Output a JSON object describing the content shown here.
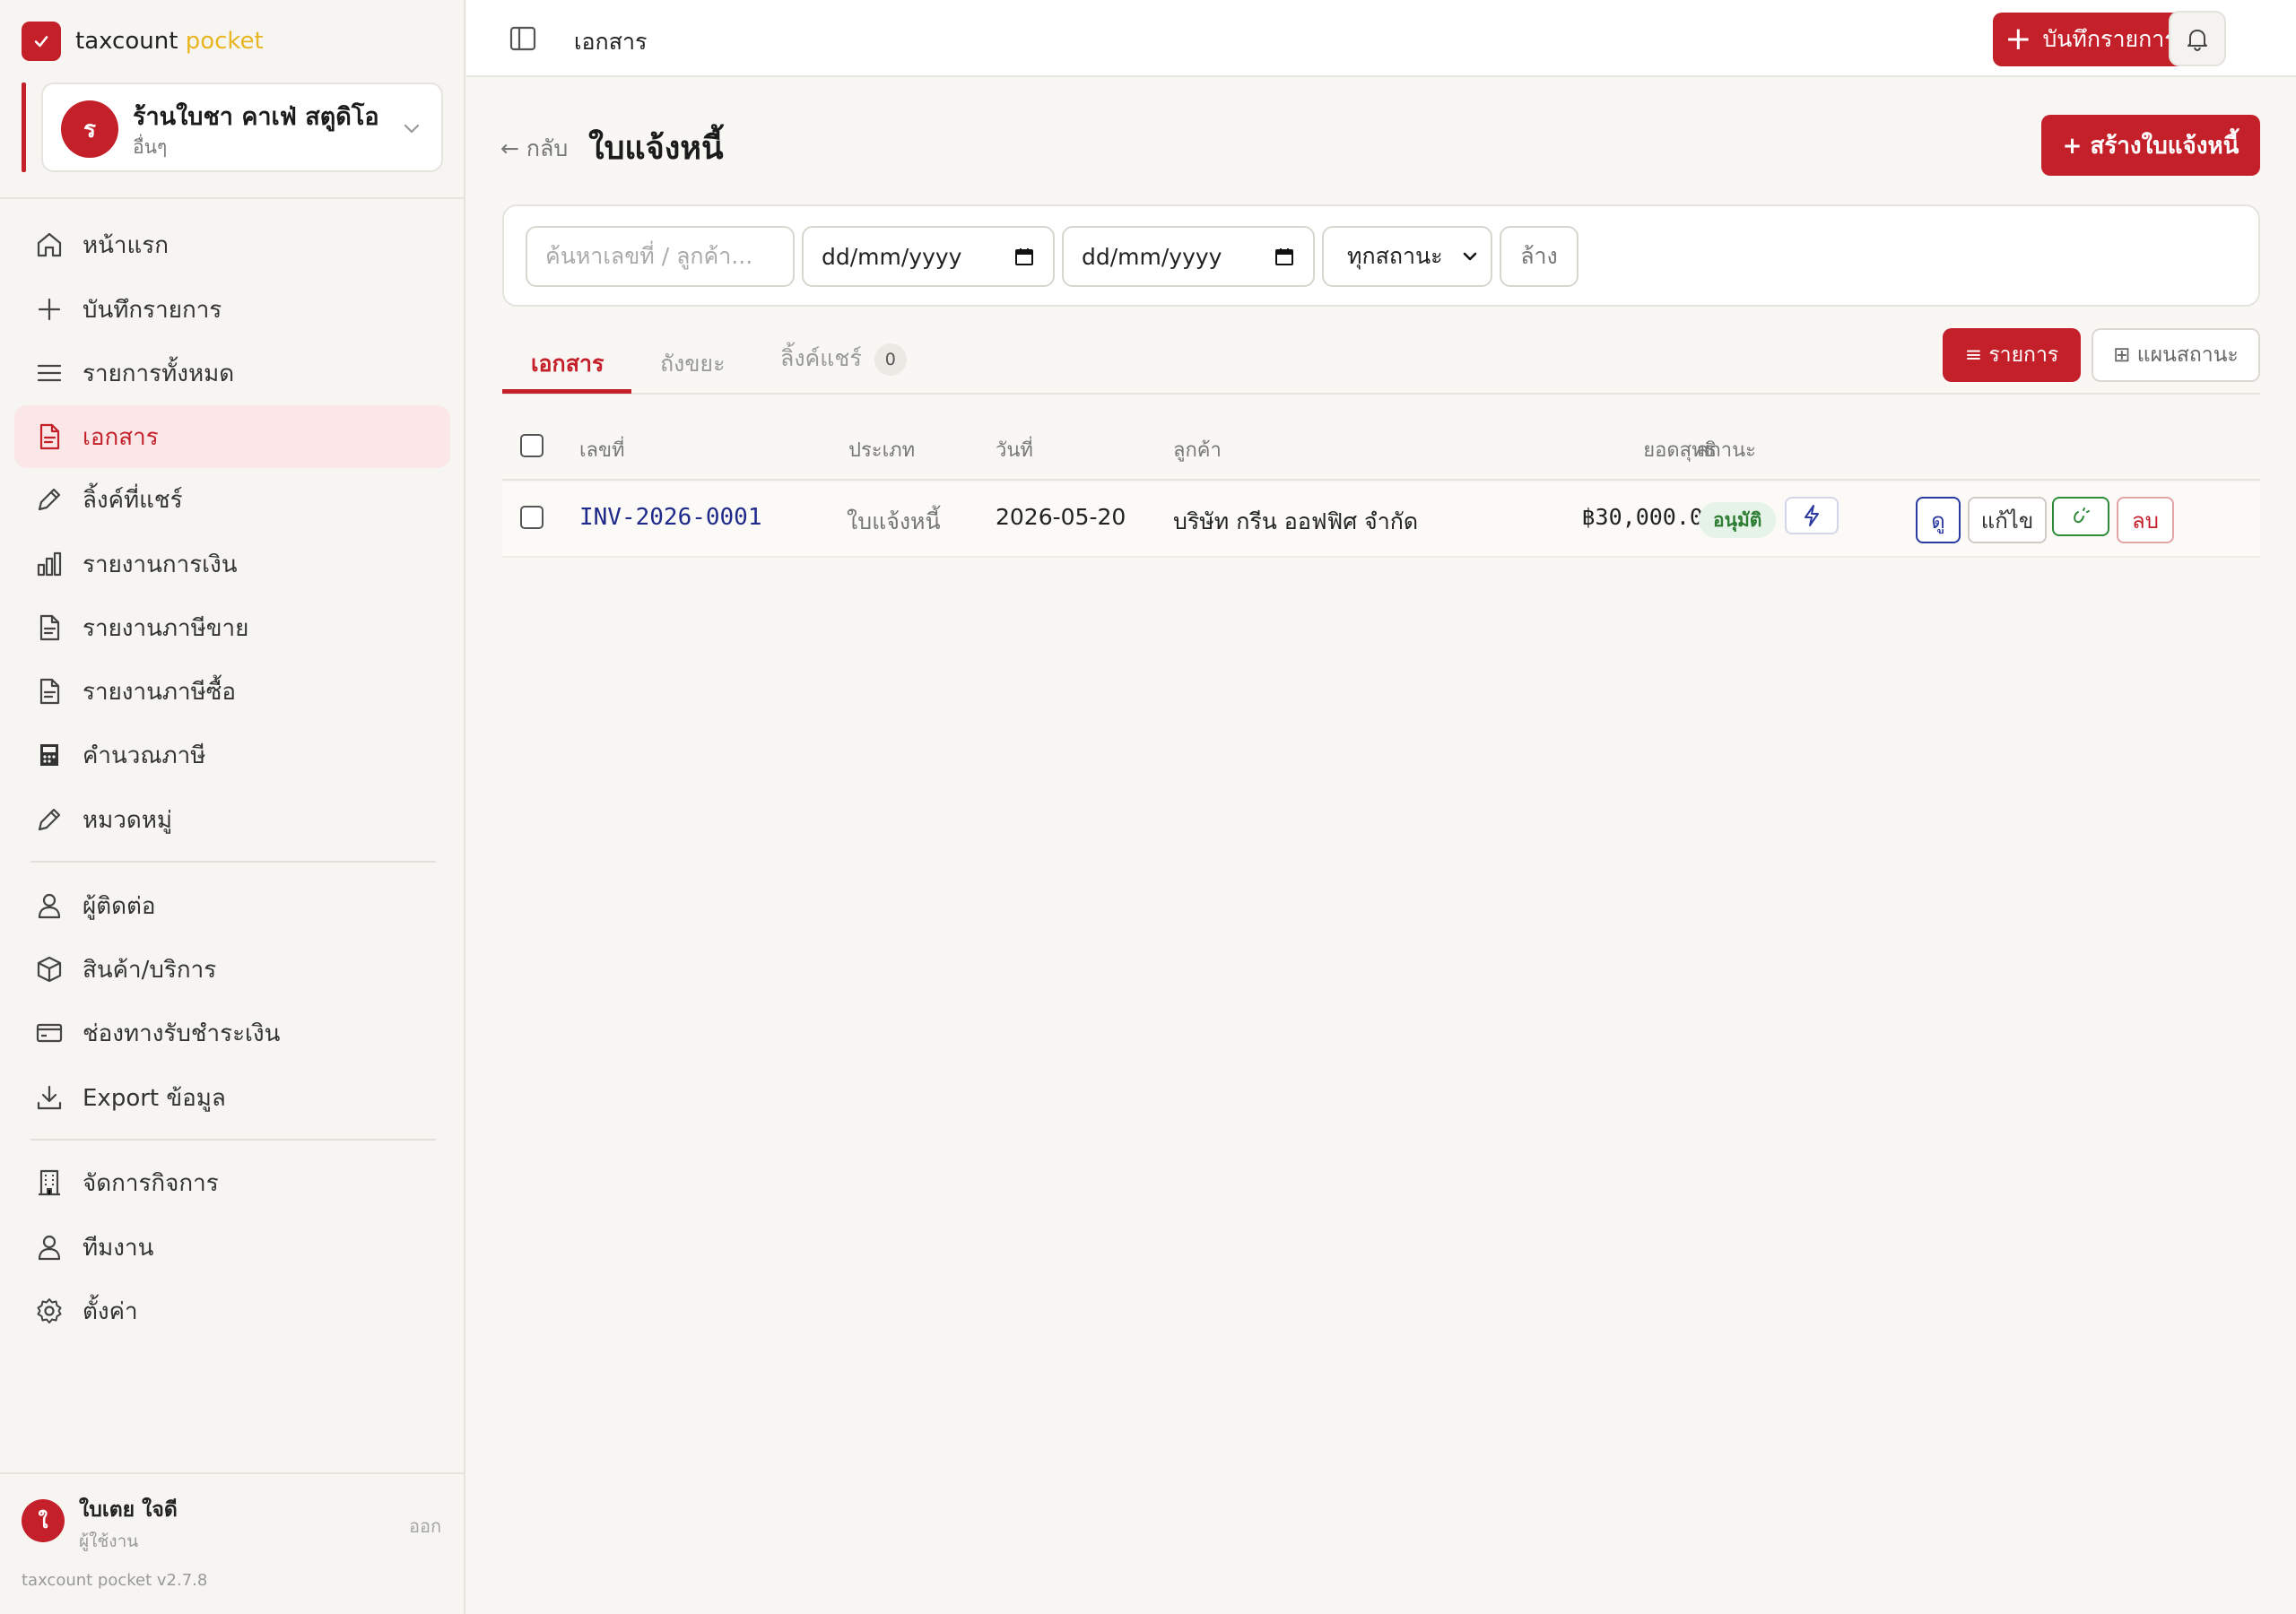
{
  "brand": {
    "name": "taxcount",
    "accent": "pocket"
  },
  "business": {
    "avatar": "ร",
    "name": "ร้านใบชา คาเฟ่ สตูดิโอ",
    "type": "อื่นๆ"
  },
  "nav": {
    "home": "หน้าแรก",
    "record": "บันทึกรายการ",
    "all_items": "รายการทั้งหมด",
    "documents": "เอกสาร",
    "share_links": "ลิ้งค์ที่แชร์",
    "finance_report": "รายงานการเงิน",
    "sales_tax_report": "รายงานภาษีขาย",
    "purchase_tax_report": "รายงานภาษีซื้อ",
    "tax_calc": "คำนวณภาษี",
    "categories": "หมวดหมู่",
    "contacts": "ผู้ติดต่อ",
    "products": "สินค้า/บริการ",
    "payment_channels": "ช่องทางรับชำระเงิน",
    "export": "Export ข้อมูล",
    "manage_business": "จัดการกิจการ",
    "team": "ทีมงาน",
    "settings": "ตั้งค่า"
  },
  "user": {
    "avatar": "ใ",
    "name": "ใบเตย ใจดี",
    "role": "ผู้ใช้งาน",
    "logout": "ออก"
  },
  "version": "taxcount pocket v2.7.8",
  "topbar": {
    "title": "เอกสาร",
    "record_button": "บันทึกรายการ"
  },
  "page": {
    "back": "← กลับ",
    "title": "ใบแจ้งหนี้",
    "create_button": "+ สร้างใบแจ้งหนี้"
  },
  "filters": {
    "search_placeholder": "ค้นหาเลขที่ / ลูกค้า...",
    "date_from": "dd/mm/yyyy",
    "date_to": "dd/mm/yyyy",
    "status": "ทุกสถานะ",
    "clear": "ล้าง"
  },
  "tabs": {
    "documents": "เอกสาร",
    "trash": "ถังขยะ",
    "shared_links": "ลิ้งค์แชร์",
    "shared_count": "0"
  },
  "views": {
    "list": "≡ รายการ",
    "board": "⊞ แผนสถานะ"
  },
  "table": {
    "headers": {
      "number": "เลขที่",
      "type": "ประเภท",
      "date": "วันที่",
      "customer": "ลูกค้า",
      "net": "ยอดสุทธิ",
      "status": "สถานะ"
    },
    "rows": [
      {
        "number": "INV-2026-0001",
        "type": "ใบแจ้งหนี้",
        "date": "2026-05-20",
        "customer": "บริษัท กรีน ออฟฟิศ จำกัด",
        "net": "฿30,000.00",
        "status": "อนุมัติ",
        "actions": {
          "view": "ดู",
          "edit": "แก้ไข",
          "delete": "ลบ"
        }
      }
    ]
  },
  "colors": {
    "brand_red": "#c4202a",
    "accent_yellow": "#e9b521",
    "link_blue": "#1f2a8a",
    "status_green": "#2d7d32"
  }
}
